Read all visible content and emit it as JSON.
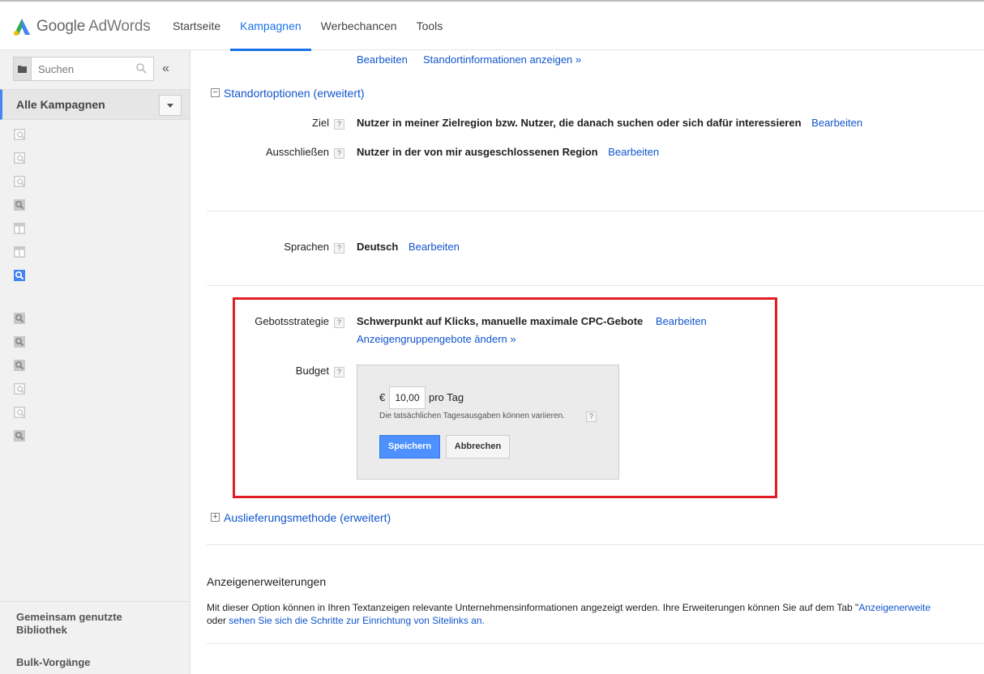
{
  "header": {
    "brand": "Google",
    "product": "AdWords",
    "nav": [
      "Startseite",
      "Kampagnen",
      "Werbechancen",
      "Tools"
    ],
    "active_nav": "Kampagnen",
    "accent_color": "#1a73e8"
  },
  "sidebar": {
    "search_placeholder": "Suchen",
    "collapse_icon": "«",
    "all_campaigns_label": "Alle Kampagnen",
    "campaign_icons": [
      "search-display-icon",
      "search-display-icon",
      "search-display-icon",
      "search-icon",
      "display-icon",
      "display-icon",
      "search-icon",
      "search-icon",
      "search-icon",
      "search-icon",
      "search-display-icon",
      "search-display-icon",
      "search-icon"
    ],
    "shared_library_label": "Gemeinsam genutzte Bibliothek",
    "bulk_label": "Bulk-Vorgänge"
  },
  "main": {
    "top_links": {
      "edit": "Bearbeiten",
      "location_info": "Standortinformationen anzeigen »"
    },
    "location_options": {
      "title": "Standortoptionen (erweitert)",
      "target_label": "Ziel",
      "target_value": "Nutzer in meiner Zielregion bzw. Nutzer, die danach suchen oder sich dafür interessieren",
      "exclude_label": "Ausschließen",
      "exclude_value": "Nutzer in der von mir ausgeschlossenen Region",
      "edit": "Bearbeiten"
    },
    "languages": {
      "label": "Sprachen",
      "value": "Deutsch",
      "edit": "Bearbeiten"
    },
    "bidding": {
      "label": "Gebotsstrategie",
      "value": "Schwerpunkt auf Klicks, manuelle maximale CPC-Gebote",
      "edit": "Bearbeiten",
      "adgroup_link": "Anzeigengruppengebote ändern »"
    },
    "budget": {
      "label": "Budget",
      "currency": "€",
      "amount": "10,00",
      "per_day": "pro Tag",
      "note": "Die tatsächlichen Tagesausgaben können variieren.",
      "save": "Speichern",
      "cancel": "Abbrechen"
    },
    "delivery": {
      "title": "Auslieferungsmethode (erweitert)"
    },
    "extensions": {
      "title": "Anzeigenerweiterungen",
      "text1": "Mit dieser Option können in Ihren Textanzeigen relevante Unternehmensinformationen angezeigt werden. Ihre Erweiterungen können Sie auf dem Tab \"",
      "link1": "Anzeigenerweite",
      "text2": "oder ",
      "link2": "sehen Sie sich die Schritte zur Einrichtung von Sitelinks an."
    },
    "help_glyph": "?",
    "highlight_color": "#e01e26"
  }
}
